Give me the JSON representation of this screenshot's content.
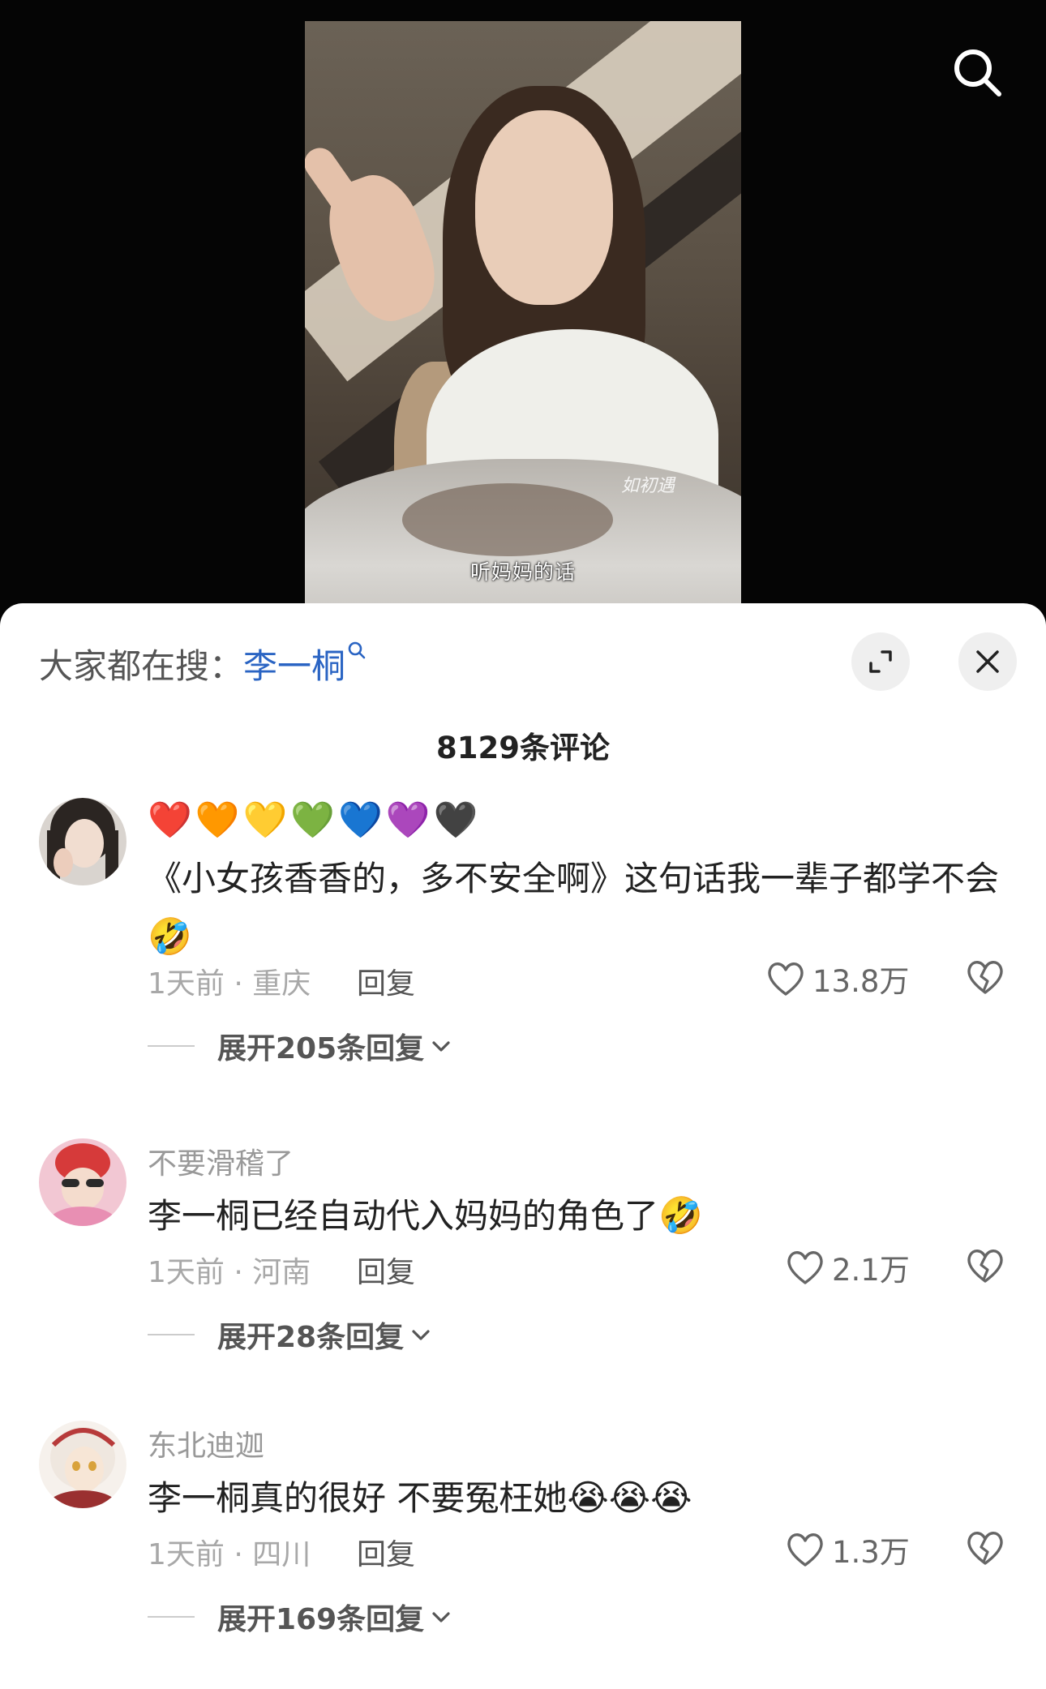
{
  "video": {
    "caption": "听妈妈的话",
    "signature": "如初遇"
  },
  "search_hint": {
    "prefix": "大家都在搜：",
    "keyword": "李一桐"
  },
  "comment_count": "8129条评论",
  "comments": [
    {
      "author": "",
      "hearts": "❤️🧡💛💚💙💜🖤",
      "text": "《小女孩香香的，多不安全啊》这句话我一辈子都学不会",
      "emoji": "🤣",
      "meta": "1天前 · 重庆",
      "reply_label": "回复",
      "likes": "13.8万",
      "expand": "展开205条回复"
    },
    {
      "author": "不要滑稽了",
      "text": "李一桐已经自动代入妈妈的角色了",
      "emoji": "🤣",
      "meta": "1天前 · 河南",
      "reply_label": "回复",
      "likes": "2.1万",
      "expand": "展开28条回复"
    },
    {
      "author": "东北迪迦",
      "text": "李一桐真的很好 不要冤枉她",
      "emoji": "😭😭😭",
      "meta": "1天前 · 四川",
      "reply_label": "回复",
      "likes": "1.3万",
      "expand": "展开169条回复"
    }
  ],
  "icons": {
    "search": "search-icon",
    "expand": "expand-icon",
    "close": "close-icon",
    "like": "heart-outline-icon",
    "dislike": "broken-heart-icon",
    "chevron": "chevron-down-icon"
  },
  "colors": {
    "keyword": "#2a64c3",
    "muted": "#a8a8a8"
  }
}
